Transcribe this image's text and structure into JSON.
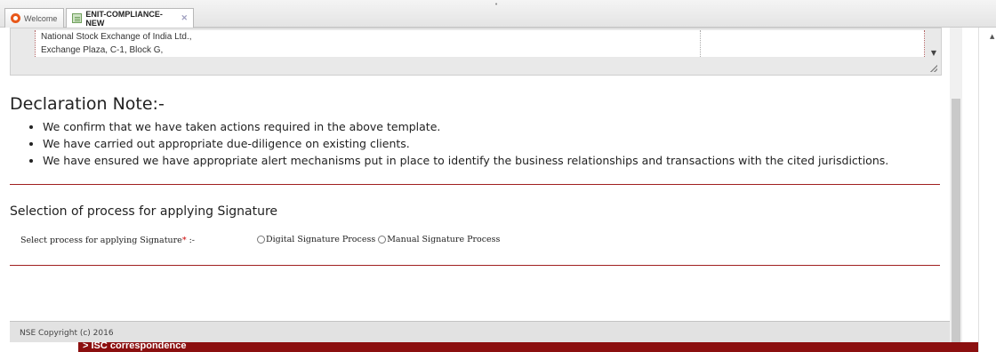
{
  "tabs": [
    {
      "label": "Welcome",
      "active": false,
      "icon": "welcome-icon"
    },
    {
      "label": "ENIT-COMPLIANCE-NEW",
      "active": true,
      "icon": "document-icon",
      "close": "✕"
    }
  ],
  "address_textarea": {
    "lines": [
      "National Stock Exchange of India Ltd.,",
      "Exchange Plaza, C-1, Block G,"
    ]
  },
  "declaration": {
    "title": "Declaration Note:-",
    "items": [
      "We confirm that we have taken actions required in the above template.",
      "We have carried out appropriate due-diligence on existing clients.",
      "We have ensured we have appropriate alert mechanisms put in place to identify the business relationships and transactions with the cited jurisdictions."
    ]
  },
  "signature": {
    "section_title": "Selection of process for applying Signature",
    "label": "Select process for applying Signature",
    "required_mark": "*",
    "label_suffix": " :-",
    "options": [
      "Digital Signature Process",
      "Manual Signature Process"
    ],
    "selected": null
  },
  "footer": {
    "copyright": "NSE Copyright (c) 2016"
  },
  "bottom_bar": {
    "label": "> ISC correspondence"
  },
  "colors": {
    "divider": "#a02020",
    "bottom_bar": "#8b0f0f",
    "required": "#cc0000"
  }
}
